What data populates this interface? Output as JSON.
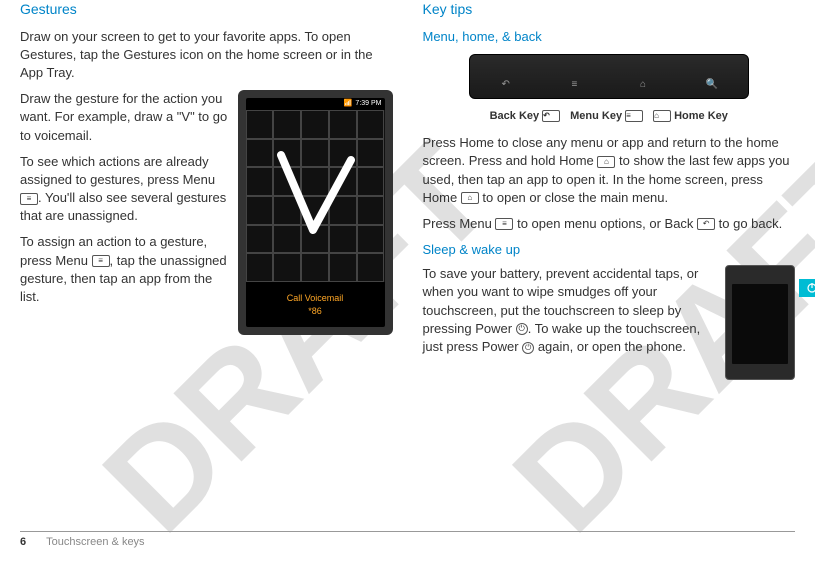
{
  "watermark": "DRAFT",
  "left": {
    "heading": "Gestures",
    "intro": "Draw on your screen to get to your favorite apps. To open Gestures, tap the Gestures icon on the home screen or in the App Tray.",
    "p1": "Draw the gesture for the action you want. For example, draw a \"V\" to go to voicemail.",
    "p2a": "To see which actions are already assigned to gestures, press Menu ",
    "p2b": ". You'll also see several gestures that are unassigned.",
    "p3a": "To assign an action to a gesture, press Menu ",
    "p3b": ", tap the unassigned gesture, then tap an app from the list.",
    "phone": {
      "time": "7:39 PM",
      "label1": "Call Voicemail",
      "label2": "*86"
    }
  },
  "right": {
    "heading": "Key tips",
    "sub1": "Menu, home, & back",
    "keys": {
      "back": "Back Key",
      "menu": "Menu Key",
      "home": "Home Key"
    },
    "p1a": "Press Home  to close any menu or app and return to the home screen. Press and hold Home ",
    "p1b": " to show the last few apps you used, then tap an app to open it. In the home screen, press Home ",
    "p1c": " to open or close the main menu.",
    "p2a": "Press Menu ",
    "p2b": " to open menu options, or Back ",
    "p2c": " to go back.",
    "sub2": "Sleep & wake up",
    "p3a": "To save your battery, prevent accidental taps, or when you want to wipe smudges off your touchscreen, put the touchscreen to sleep by pressing Power ",
    "p3b": ". To wake up the touchscreen, just press Power ",
    "p3c": " again, or open the phone."
  },
  "footer": {
    "page": "6",
    "section": "Touchscreen & keys"
  }
}
